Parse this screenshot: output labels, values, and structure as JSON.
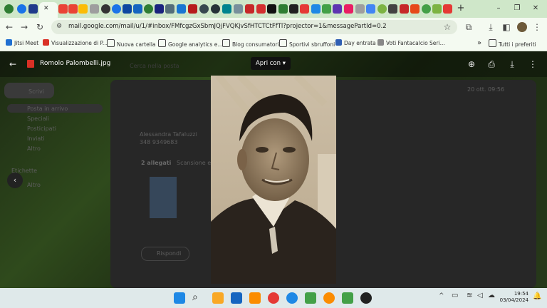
{
  "browser": {
    "url": "mail.google.com/mail/u/1/#inbox/FMfcgzGxSbmJQjFVQKjvSfHTCTCtFfTl?projector=1&messagePartId=0.2",
    "new_tab_label": "+",
    "window_controls": {
      "minimize": "–",
      "restore": "❐",
      "close": "✕"
    }
  },
  "bookmarks": [
    {
      "label": "Jitsi Meet",
      "icon_color": "#1f6fd1"
    },
    {
      "label": "Visualizzazione di P...",
      "icon_color": "#d93025"
    },
    {
      "label": "Nuova cartella",
      "icon_color": "#444444"
    },
    {
      "label": "Google analytics e...",
      "icon_color": "#444444"
    },
    {
      "label": "Blog consumatori",
      "icon_color": "#444444"
    },
    {
      "label": "Sportivi sbruffoni",
      "icon_color": "#444444"
    },
    {
      "label": "Day entrata",
      "icon_color": "#2f5fb3"
    },
    {
      "label": "Voti Fantacalcio Seri...",
      "icon_color": "#888888"
    }
  ],
  "bookmarks_more": "»",
  "bookmarks_all": "Tutti i preferiti",
  "viewer": {
    "filename": "Romolo Palombelli.jpg",
    "open_with": "Apri con",
    "back_icon": "←",
    "add_to_drive": "⊕",
    "print": "⎙",
    "download": "⤓",
    "more": "⋮"
  },
  "gmail_bg": {
    "search_placeholder": "Cerca nella posta",
    "compose": "Scrivi",
    "folders": [
      "Posta in arrivo",
      "Speciali",
      "Posticipati",
      "Inviati",
      "Altro"
    ],
    "labels_header": "Etichette",
    "labels": [
      "Altro"
    ],
    "sender_name": "Alessandra Tafaluzzi",
    "sender_phone": "348 9349683",
    "attachments": "2 allegati",
    "attachments_sub": "Scansione e...",
    "reply": "Rispondi",
    "date": "20 ott. 09:56"
  },
  "taskbar": {
    "time": "19:54",
    "date": "03/04/2024"
  }
}
